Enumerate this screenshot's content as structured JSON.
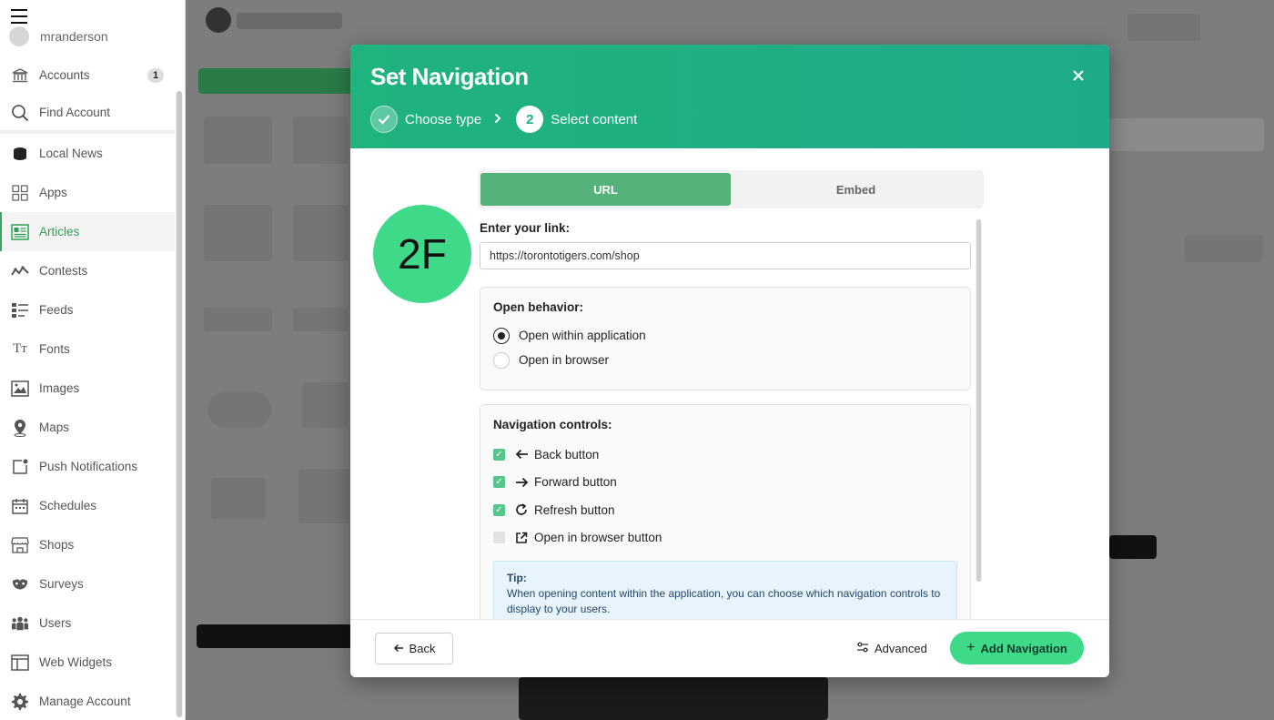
{
  "sidebar": {
    "username": "mranderson",
    "items": [
      {
        "label": "Accounts",
        "badge": "1"
      },
      {
        "label": "Find Account"
      },
      {
        "label": "Local News"
      },
      {
        "label": "Apps"
      },
      {
        "label": "Articles"
      },
      {
        "label": "Contests"
      },
      {
        "label": "Feeds"
      },
      {
        "label": "Fonts"
      },
      {
        "label": "Images"
      },
      {
        "label": "Maps"
      },
      {
        "label": "Push Notifications"
      },
      {
        "label": "Schedules"
      },
      {
        "label": "Shops"
      },
      {
        "label": "Surveys"
      },
      {
        "label": "Users"
      },
      {
        "label": "Web Widgets"
      },
      {
        "label": "Manage Account"
      }
    ],
    "active_item": "Articles"
  },
  "modal": {
    "title": "Set Navigation",
    "steps": [
      {
        "label": "Choose type",
        "state": "done"
      },
      {
        "number": "2",
        "label": "Select content",
        "state": "current"
      }
    ],
    "tabs": [
      {
        "label": "URL",
        "active": true
      },
      {
        "label": "Embed",
        "active": false
      }
    ],
    "preview_initials": "2F",
    "link_label": "Enter your link:",
    "link_value": "https://torontotigers.com/shop",
    "open_behavior": {
      "title": "Open behavior:",
      "options": [
        {
          "label": "Open within application",
          "selected": true
        },
        {
          "label": "Open in browser",
          "selected": false
        }
      ]
    },
    "navigation_controls": {
      "title": "Navigation controls:",
      "items": [
        {
          "label": "Back button",
          "checked": true,
          "icon": "arrow-left-icon"
        },
        {
          "label": "Forward button",
          "checked": true,
          "icon": "arrow-right-icon"
        },
        {
          "label": "Refresh button",
          "checked": true,
          "icon": "refresh-icon"
        },
        {
          "label": "Open in browser button",
          "checked": false,
          "icon": "external-link-icon"
        }
      ]
    },
    "tip": {
      "title": "Tip:",
      "text": "When opening content within the application, you can choose which navigation controls to display to your users."
    },
    "footer": {
      "back": "Back",
      "advanced": "Advanced",
      "add": "Add Navigation"
    }
  },
  "colors": {
    "header_green": "#1fb37d",
    "accent_green": "#3fd98a",
    "tab_active": "#55b27a",
    "sidebar_active": "#2f9e55"
  }
}
